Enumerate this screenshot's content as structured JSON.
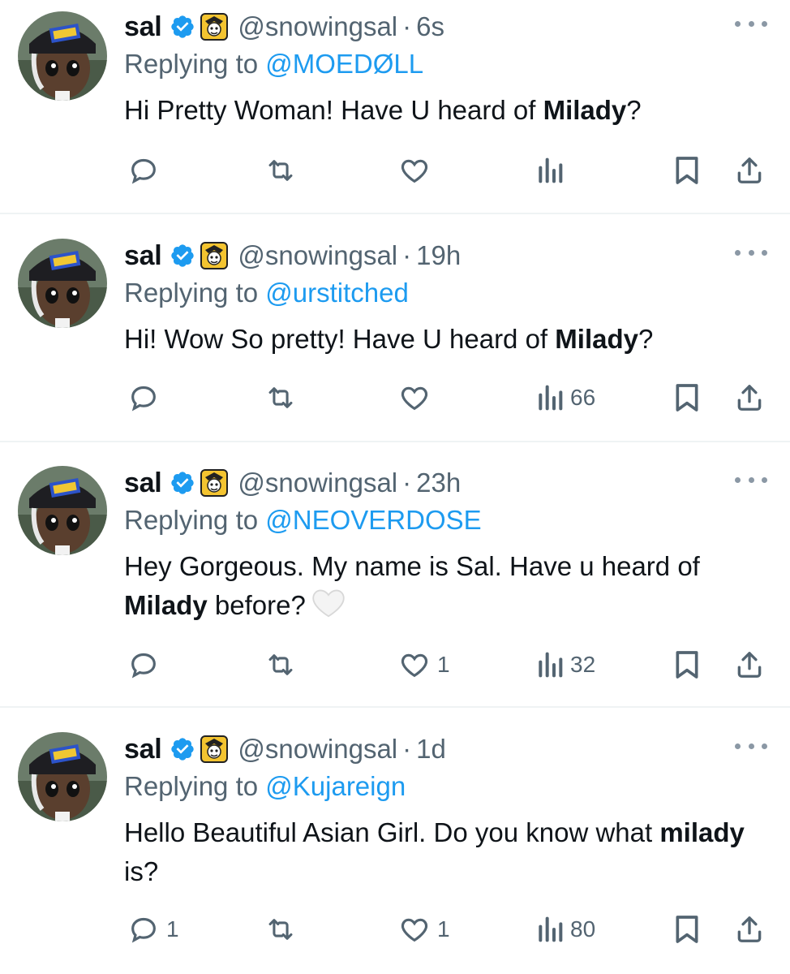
{
  "colors": {
    "accent": "#1d9bf0",
    "muted": "#536471",
    "text": "#0f1419",
    "verified": "#1d9bf0"
  },
  "icons": [
    "verified-badge-icon",
    "affiliate-badge-icon",
    "more-icon",
    "reply-icon",
    "retweet-icon",
    "like-icon",
    "views-icon",
    "bookmark-icon",
    "share-icon",
    "white-heart-emoji"
  ],
  "tweets": [
    {
      "name": "sal",
      "handle": "@snowingsal",
      "dot": "·",
      "time": "6s",
      "replying_prefix": "Replying to ",
      "replying_to": "@MOEDØLL",
      "text_before": "Hi Pretty Woman! Have U heard of ",
      "text_bold": "Milady",
      "text_after": "?",
      "replies": "",
      "retweets": "",
      "likes": "",
      "views": ""
    },
    {
      "name": "sal",
      "handle": "@snowingsal",
      "dot": "·",
      "time": "19h",
      "replying_prefix": "Replying to ",
      "replying_to": "@urstitched",
      "text_before": "Hi! Wow So pretty! Have U heard of ",
      "text_bold": "Milady",
      "text_after": "?",
      "replies": "",
      "retweets": "",
      "likes": "",
      "views": "66"
    },
    {
      "name": "sal",
      "handle": "@snowingsal",
      "dot": "·",
      "time": "23h",
      "replying_prefix": "Replying to ",
      "replying_to": "@NEOVERDOSE",
      "text_before": "Hey Gorgeous. My name is Sal. Have u heard of ",
      "text_bold": "Milady",
      "text_after": " before?",
      "replies": "",
      "retweets": "",
      "likes": "1",
      "views": "32"
    },
    {
      "name": "sal",
      "handle": "@snowingsal",
      "dot": "·",
      "time": "1d",
      "replying_prefix": "Replying to ",
      "replying_to": "@Kujareign",
      "text_before": "Hello Beautiful Asian Girl. Do you know what ",
      "text_bold": "milady",
      "text_after": " is?",
      "replies": "1",
      "retweets": "",
      "likes": "1",
      "views": "80"
    }
  ]
}
